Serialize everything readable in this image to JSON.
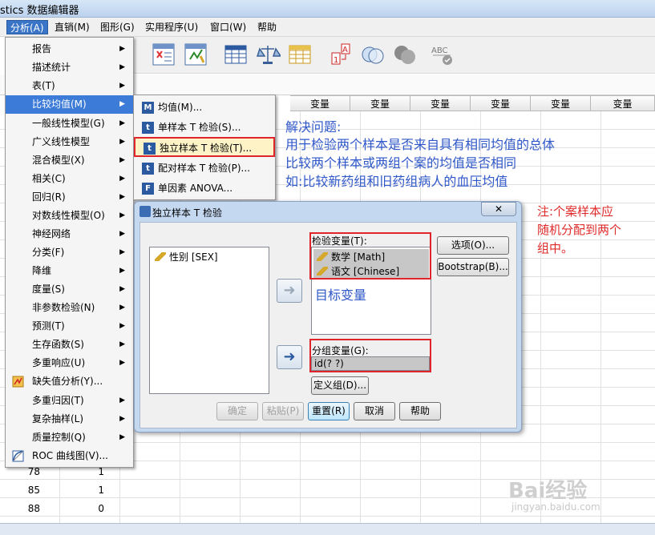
{
  "window": {
    "title": "stics 数据编辑器"
  },
  "menubar": [
    {
      "label": "分析(A)",
      "active": true
    },
    {
      "label": "直销(M)"
    },
    {
      "label": "图形(G)"
    },
    {
      "label": "实用程序(U)"
    },
    {
      "label": "窗口(W)"
    },
    {
      "label": "帮助"
    }
  ],
  "grid": {
    "var_header": "变量",
    "rows": [
      {
        "value": "78",
        "num": "1"
      },
      {
        "value": "85",
        "num": "1"
      },
      {
        "value": "88",
        "num": "0"
      }
    ]
  },
  "analyze_menu": {
    "items": [
      {
        "label": "报告"
      },
      {
        "label": "描述统计"
      },
      {
        "label": "表(T)"
      },
      {
        "label": "比较均值(M)"
      },
      {
        "label": "一般线性模型(G)"
      },
      {
        "label": "广义线性模型"
      },
      {
        "label": "混合模型(X)"
      },
      {
        "label": "相关(C)"
      },
      {
        "label": "回归(R)"
      },
      {
        "label": "对数线性模型(O)"
      },
      {
        "label": "神经网络"
      },
      {
        "label": "分类(F)"
      },
      {
        "label": "降维"
      },
      {
        "label": "度量(S)"
      },
      {
        "label": "非参数检验(N)"
      },
      {
        "label": "预测(T)"
      },
      {
        "label": "生存函数(S)"
      },
      {
        "label": "多重响应(U)"
      },
      {
        "label": "缺失值分析(Y)..."
      },
      {
        "label": "多重归因(T)"
      },
      {
        "label": "复杂抽样(L)"
      },
      {
        "label": "质量控制(Q)"
      },
      {
        "label": "ROC 曲线图(V)..."
      }
    ]
  },
  "compare_means_submenu": {
    "items": [
      {
        "label": "均值(M)...",
        "icon": "M"
      },
      {
        "label": "单样本 T 检验(S)...",
        "icon": "t"
      },
      {
        "label": "独立样本 T 检验(T)...",
        "icon": "t"
      },
      {
        "label": "配对样本 T 检验(P)...",
        "icon": "t"
      },
      {
        "label": "单因素 ANOVA...",
        "icon": "F"
      }
    ]
  },
  "dialog": {
    "title": "独立样本 T 检验",
    "close": "✕",
    "source_vars": [
      "性别 [SEX]"
    ],
    "test_var_label": "检验变量(T):",
    "test_vars": [
      "数学 [Math]",
      "语文 [Chinese]"
    ],
    "group_var_label": "分组变量(G):",
    "group_var_value": "id(? ?)",
    "define_groups": "定义组(D)...",
    "options": "选项(O)...",
    "bootstrap": "Bootstrap(B)...",
    "ok": "确定",
    "paste": "粘贴(P)",
    "reset": "重置(R)",
    "cancel": "取消",
    "help": "帮助"
  },
  "annotations": {
    "target_var": "目标变量",
    "problem_title": "解决问题:",
    "problem_line1": "用于检验两个样本是否来自具有相同均值的总体",
    "problem_line2": "比较两个样本或两组个案的均值是否相同",
    "problem_line3": "如:比较新药组和旧药组病人的血压均值",
    "note_line1": "注:个案样本应",
    "note_line2": "随机分配到两个",
    "note_line3": "组中。"
  },
  "watermark": {
    "text": "Bai经验",
    "url": "jingyan.baidu.com"
  },
  "colors": {
    "accent": "#3d7bd8",
    "highlight_red": "#e0242c",
    "annotation_blue": "#2f57c8"
  }
}
